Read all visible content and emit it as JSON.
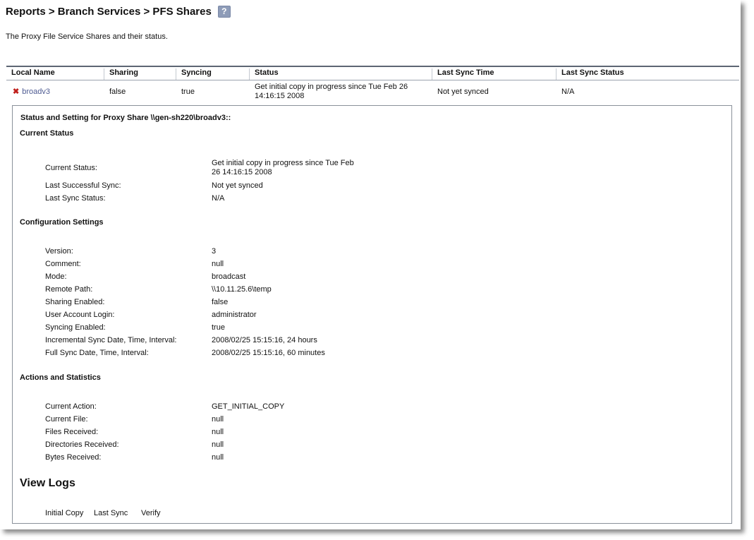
{
  "page": {
    "breadcrumb": "Reports > Branch Services > PFS Shares",
    "help_symbol": "?",
    "description": "The Proxy File Service Shares and their status."
  },
  "table": {
    "headers": [
      "Local Name",
      "Sharing",
      "Syncing",
      "Status",
      "Last Sync Time",
      "Last Sync Status"
    ],
    "rows": [
      {
        "local_name": "broadv3",
        "sharing": "false",
        "syncing": "true",
        "status_line1": "Get initial copy in progress since Tue Feb 26",
        "status_line2": "14:16:15 2008",
        "last_sync_time": "Not yet synced",
        "last_sync_status": "N/A"
      }
    ]
  },
  "detail": {
    "heading": "Status and Setting for Proxy Share \\\\gen-sh220\\broadv3::",
    "current_status": {
      "title": "Current Status",
      "items": [
        {
          "label": "Current Status:",
          "value_line1": "Get initial copy in progress since Tue Feb",
          "value_line2": "26 14:16:15 2008"
        },
        {
          "label": "Last Successful Sync:",
          "value": "Not yet synced"
        },
        {
          "label": "Last Sync Status:",
          "value": "N/A"
        }
      ]
    },
    "configuration": {
      "title": "Configuration Settings",
      "items": [
        {
          "label": "Version:",
          "value": "3"
        },
        {
          "label": "Comment:",
          "value": "null"
        },
        {
          "label": "Mode:",
          "value": "broadcast"
        },
        {
          "label": "Remote Path:",
          "value": "\\\\10.11.25.6\\temp"
        },
        {
          "label": "Sharing Enabled:",
          "value": "false"
        },
        {
          "label": "User Account Login:",
          "value": "administrator"
        },
        {
          "label": "Syncing Enabled:",
          "value": "true"
        },
        {
          "label": "Incremental Sync Date, Time, Interval:",
          "value": "2008/02/25 15:15:16, 24 hours"
        },
        {
          "label": "Full Sync Date, Time, Interval:",
          "value": "2008/02/25 15:15:16, 60 minutes"
        }
      ]
    },
    "actions": {
      "title": "Actions and Statistics",
      "items": [
        {
          "label": "Current Action:",
          "value": "GET_INITIAL_COPY"
        },
        {
          "label": "Current File:",
          "value": "null"
        },
        {
          "label": "Files Received:",
          "value": "null"
        },
        {
          "label": "Directories Received:",
          "value": "null"
        },
        {
          "label": "Bytes Received:",
          "value": "null"
        }
      ]
    },
    "logs": {
      "title": "View Logs",
      "links": [
        "Initial Copy",
        "Last Sync",
        "Verify"
      ]
    }
  },
  "colors": {
    "link": "#4e5b92",
    "error_icon": "#c0201c",
    "help_icon": "#8e9cb8"
  }
}
